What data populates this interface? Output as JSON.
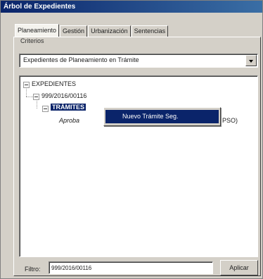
{
  "window": {
    "title": "Árbol de Expedientes"
  },
  "tabs": [
    {
      "label": "Planeamiento",
      "active": true
    },
    {
      "label": "Gestión",
      "active": false
    },
    {
      "label": "Urbanización",
      "active": false
    },
    {
      "label": "Sentencias",
      "active": false
    }
  ],
  "criteria": {
    "label": "Criterios",
    "selected": "Expedientes de Planeamiento en Trámite"
  },
  "tree": {
    "root": "EXPEDIENTES",
    "expediente": "999/2016/00116",
    "tramites": "TRÁMITES",
    "child_partial_left": "Aproba",
    "child_partial_right": "PSO)"
  },
  "context_menu": {
    "item": "Nuevo Trámite Seg."
  },
  "filter": {
    "label": "Filtro:",
    "value": "999/2016/00116",
    "apply_label": "Aplicar"
  }
}
